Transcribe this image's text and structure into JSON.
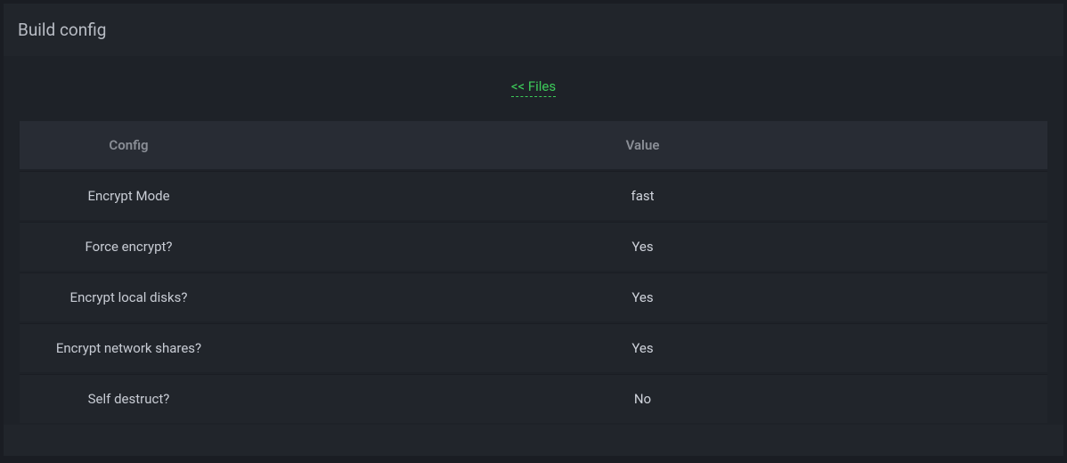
{
  "header": {
    "title": "Build config"
  },
  "back_link": {
    "label": "<< Files"
  },
  "table": {
    "headers": {
      "config": "Config",
      "value": "Value"
    },
    "rows": [
      {
        "config": "Encrypt Mode",
        "value": "fast"
      },
      {
        "config": "Force encrypt?",
        "value": "Yes"
      },
      {
        "config": "Encrypt local disks?",
        "value": "Yes"
      },
      {
        "config": "Encrypt network shares?",
        "value": "Yes"
      },
      {
        "config": "Self destruct?",
        "value": "No"
      }
    ]
  }
}
